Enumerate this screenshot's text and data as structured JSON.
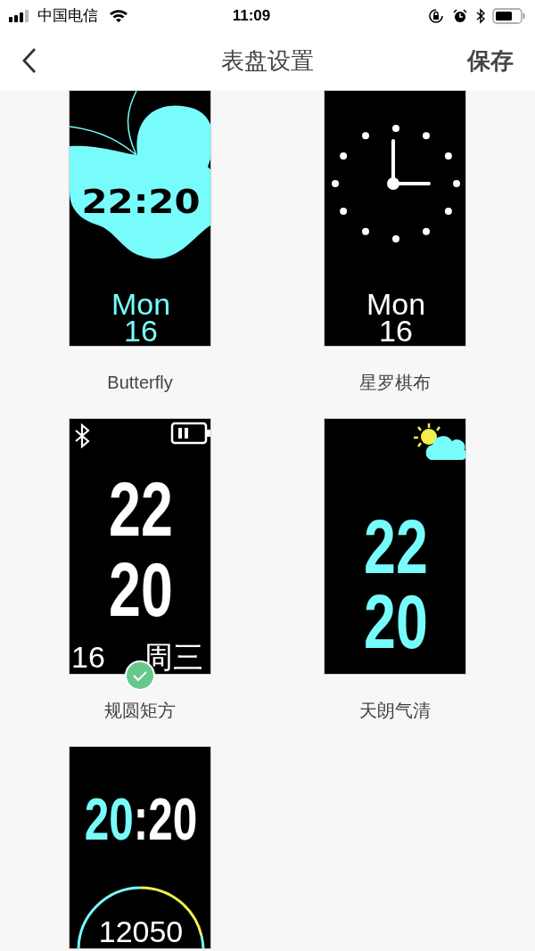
{
  "status_bar": {
    "carrier": "中国电信",
    "time": "11:09"
  },
  "nav": {
    "title": "表盘设置",
    "action": "保存"
  },
  "faces": [
    {
      "kind": "butterfly",
      "name": "Butterfly",
      "selected": false,
      "time": "22:20",
      "day": "Mon",
      "date": "16"
    },
    {
      "kind": "analog",
      "name": "星罗棋布",
      "selected": false,
      "day": "Mon",
      "date": "16"
    },
    {
      "kind": "block",
      "name": "规圆矩方",
      "selected": true,
      "hour": "22",
      "minute": "20",
      "date": "16",
      "weekday": "周三"
    },
    {
      "kind": "weather",
      "name": "天朗气清",
      "selected": false,
      "hour": "22",
      "minute": "20"
    },
    {
      "kind": "ring",
      "selected": false,
      "hour": "20",
      "separator": ":",
      "minute": "20",
      "steps": "12050"
    }
  ]
}
